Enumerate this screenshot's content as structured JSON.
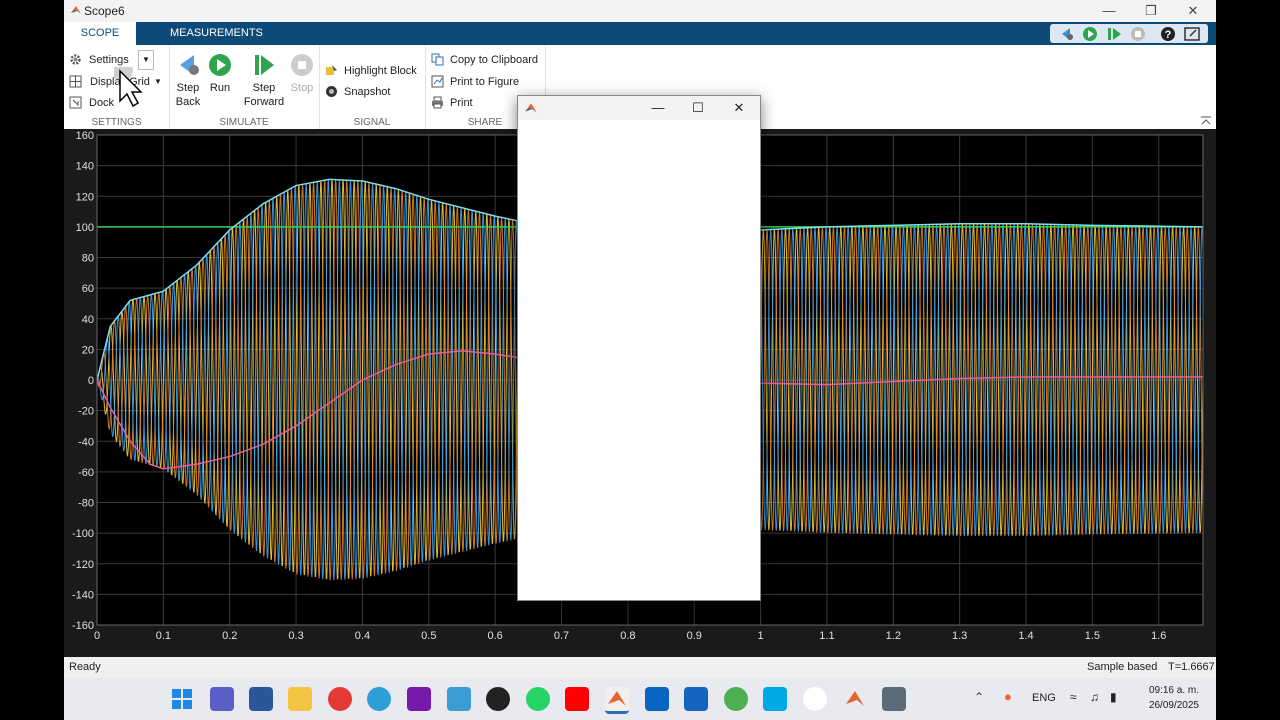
{
  "window": {
    "title": "Scope6"
  },
  "tabs": [
    {
      "label": "SCOPE"
    },
    {
      "label": "MEASUREMENTS"
    }
  ],
  "ribbon": {
    "settings": {
      "settings_label": "Settings",
      "display_grid_label": "Display Grid",
      "dock_label": "Dock",
      "group_label": "SETTINGS"
    },
    "simulate": {
      "step_back_l1": "Step",
      "step_back_l2": "Back",
      "run_label": "Run",
      "step_fwd_l1": "Step",
      "step_fwd_l2": "Forward",
      "stop_label": "Stop",
      "group_label": "SIMULATE"
    },
    "signal": {
      "highlight_label": "Highlight Block",
      "snapshot_label": "Snapshot",
      "group_label": "SIGNAL"
    },
    "share": {
      "copy_label": "Copy to Clipboard",
      "print_fig_label": "Print to Figure",
      "print_label": "Print",
      "group_label": "SHARE"
    }
  },
  "status": {
    "left": "Ready",
    "mode": "Sample based",
    "time": "T=1.6667"
  },
  "taskbar": {
    "lang": "ENG",
    "clock_time": "09:16 a. m.",
    "clock_date": "26/09/2025"
  },
  "colors": {
    "tabbar": "#0e4a78",
    "plot_bg": "#000000",
    "grid": "#3a3a3a",
    "phase_a": "#f5d33c",
    "phase_b": "#e8832b",
    "phase_c": "#3fa9f5",
    "envelope": "#7fe0f0",
    "reference": "#3ccf4e",
    "error": "#e85aa8"
  },
  "chart_data": {
    "type": "line",
    "title": "",
    "xlabel": "",
    "ylabel": "",
    "xlim": [
      0,
      1.6667
    ],
    "ylim": [
      -160,
      160
    ],
    "x_ticks": [
      "0",
      "0.1",
      "0.2",
      "0.3",
      "0.4",
      "0.5",
      "0.6",
      "0.7",
      "0.8",
      "0.9",
      "1",
      "1.1",
      "1.2",
      "1.3",
      "1.4",
      "1.5",
      "1.6"
    ],
    "y_ticks": [
      "160",
      "140",
      "120",
      "100",
      "80",
      "60",
      "40",
      "20",
      "0",
      "-20",
      "-40",
      "-60",
      "-80",
      "-100",
      "-120",
      "-140",
      "-160"
    ],
    "grid": true,
    "oscillation_frequency_hz": 60,
    "series": [
      {
        "color": "#f5d33c",
        "phase_deg": 0
      },
      {
        "color": "#e8832b",
        "phase_deg": 120
      },
      {
        "color": "#3fa9f5",
        "phase_deg": 240
      },
      {
        "color": "#3ccf4e",
        "x": [
          0,
          1.6667
        ],
        "y": [
          100,
          100
        ]
      },
      {
        "color": "#7fe0f0",
        "x": [
          0,
          0.02,
          0.05,
          0.1,
          0.15,
          0.2,
          0.25,
          0.3,
          0.35,
          0.4,
          0.45,
          0.5,
          0.6,
          0.7,
          0.8,
          0.9,
          1.0,
          1.1,
          1.2,
          1.3,
          1.4,
          1.5,
          1.6667
        ],
        "y": [
          0,
          35,
          52,
          58,
          75,
          98,
          115,
          127,
          131,
          130,
          125,
          118,
          107,
          98,
          96,
          97,
          98,
          100,
          101,
          102,
          102,
          101,
          100
        ]
      },
      {
        "color": "#e85aa8",
        "x": [
          0,
          0.02,
          0.05,
          0.08,
          0.1,
          0.15,
          0.2,
          0.25,
          0.3,
          0.35,
          0.4,
          0.45,
          0.5,
          0.55,
          0.6,
          0.7,
          0.8,
          0.9,
          1.0,
          1.1,
          1.2,
          1.3,
          1.4,
          1.5,
          1.6667
        ],
        "y": [
          0,
          -18,
          -40,
          -55,
          -58,
          -55,
          -50,
          -42,
          -30,
          -15,
          0,
          10,
          17,
          19,
          17,
          10,
          4,
          0,
          -2,
          -3,
          -1,
          1,
          2,
          2,
          2
        ]
      }
    ]
  }
}
